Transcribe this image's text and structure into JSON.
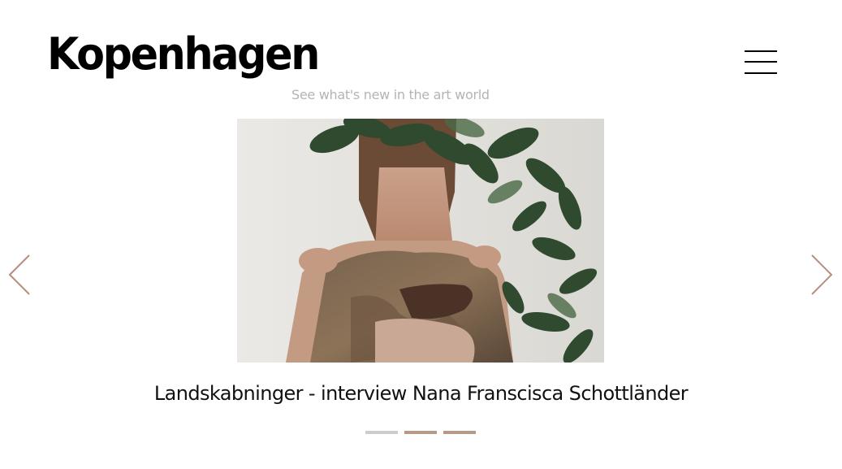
{
  "header": {
    "logo_text": "Kopenhagen",
    "tagline": "See what's new in the art world",
    "menu_icon": "hamburger-menu-icon"
  },
  "slider": {
    "prev_icon": "chevron-left-icon",
    "next_icon": "chevron-right-icon",
    "caption": "Landskabninger - interview Nana Franscisca Schottländer",
    "image_description_icon": "slide-photo",
    "dots": [
      {
        "active": true,
        "color": "#cccccc"
      },
      {
        "active": false,
        "color": "#b59a88"
      },
      {
        "active": false,
        "color": "#b59a88"
      }
    ],
    "arrow_color": "#b58e7c"
  }
}
